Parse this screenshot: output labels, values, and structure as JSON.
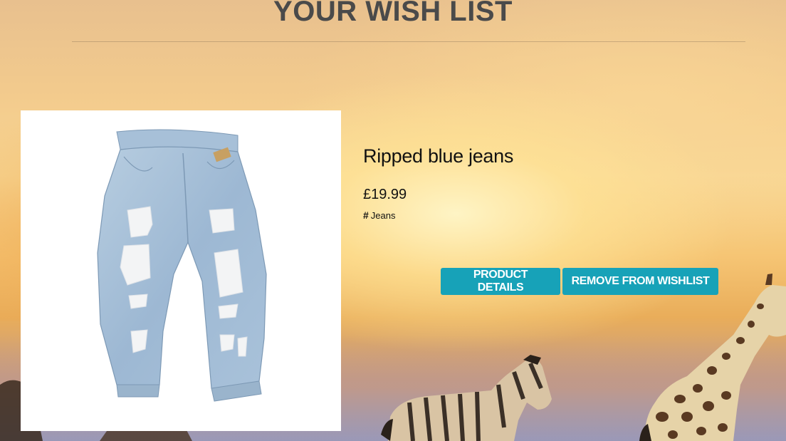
{
  "page": {
    "title": "YOUR WISH LIST"
  },
  "wishlist": {
    "items": [
      {
        "name": "Ripped blue jeans",
        "price": "£19.99",
        "tag_icon": "#",
        "tag": "Jeans",
        "image_icon": "jeans-icon",
        "details_label": "PRODUCT DETAILS",
        "remove_label": "REMOVE FROM WISHLIST"
      }
    ]
  },
  "colors": {
    "button": "#17a2b8",
    "title": "#4a4a4a",
    "text": "#111111"
  }
}
